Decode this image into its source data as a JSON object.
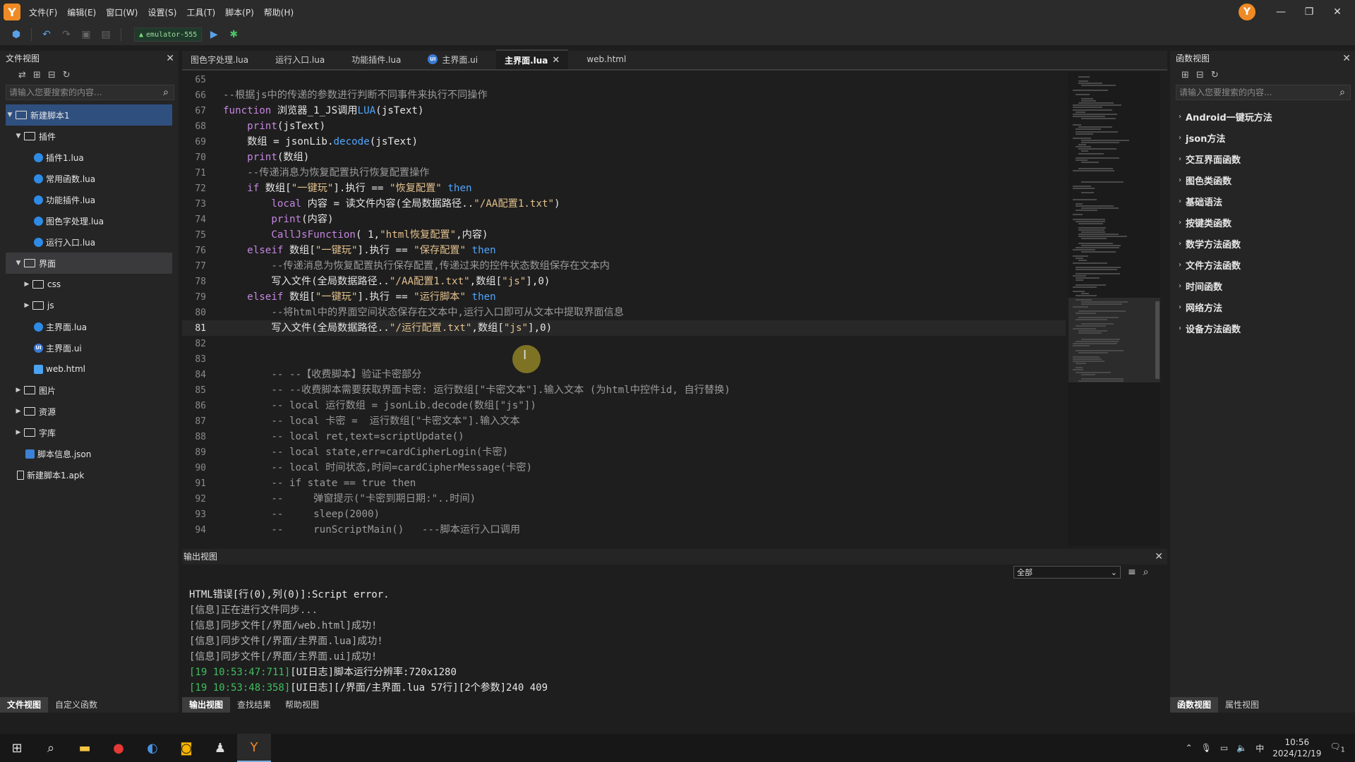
{
  "menu": {
    "items": [
      "文件(F)",
      "编辑(E)",
      "窗口(W)",
      "设置(S)",
      "工具(T)",
      "脚本(P)",
      "帮助(H)"
    ],
    "avatar_letter": "Y"
  },
  "toolbar": {
    "device": "emulator-555"
  },
  "file_view": {
    "title": "文件视图",
    "search_placeholder": "请输入您要搜索的内容...",
    "tree": [
      {
        "label": "新建脚本1",
        "type": "folder",
        "depth": 0,
        "expanded": true,
        "selected": true
      },
      {
        "label": "插件",
        "type": "folder",
        "depth": 1,
        "expanded": true
      },
      {
        "label": "插件1.lua",
        "type": "lua",
        "depth": 2
      },
      {
        "label": "常用函数.lua",
        "type": "lua",
        "depth": 2
      },
      {
        "label": "功能插件.lua",
        "type": "lua",
        "depth": 2
      },
      {
        "label": "图色字处理.lua",
        "type": "lua",
        "depth": 2
      },
      {
        "label": "运行入口.lua",
        "type": "lua",
        "depth": 2
      },
      {
        "label": "界面",
        "type": "folder",
        "depth": 1,
        "expanded": true,
        "highlight": true
      },
      {
        "label": "css",
        "type": "folder",
        "depth": 2,
        "expanded": false
      },
      {
        "label": "js",
        "type": "folder",
        "depth": 2,
        "expanded": false
      },
      {
        "label": "主界面.lua",
        "type": "lua",
        "depth": 2
      },
      {
        "label": "主界面.ui",
        "type": "ui",
        "depth": 2
      },
      {
        "label": "web.html",
        "type": "html",
        "depth": 2
      },
      {
        "label": "图片",
        "type": "folder",
        "depth": 1,
        "expanded": false
      },
      {
        "label": "资源",
        "type": "folder",
        "depth": 1,
        "expanded": false
      },
      {
        "label": "字库",
        "type": "folder",
        "depth": 1,
        "expanded": false
      },
      {
        "label": "脚本信息.json",
        "type": "json",
        "depth": 1
      },
      {
        "label": "新建脚本1.apk",
        "type": "apk",
        "depth": 0
      }
    ],
    "bottom_tabs": [
      "文件视图",
      "自定义函数"
    ]
  },
  "editor": {
    "tabs": [
      {
        "label": "图色字处理.lua",
        "icon": ""
      },
      {
        "label": "运行入口.lua",
        "icon": ""
      },
      {
        "label": "功能插件.lua",
        "icon": ""
      },
      {
        "label": "主界面.ui",
        "icon": "UI"
      },
      {
        "label": "主界面.lua",
        "icon": "",
        "active": true
      },
      {
        "label": "web.html",
        "icon": ""
      }
    ],
    "current_line": 81,
    "lines": [
      {
        "n": "65",
        "segs": []
      },
      {
        "n": "66",
        "segs": [
          {
            "t": "--根据js中的传递的参数进行判断不同事件来执行不同操作",
            "c": "c-comment"
          }
        ]
      },
      {
        "n": "67",
        "segs": [
          {
            "t": "function ",
            "c": "c-kw"
          },
          {
            "t": "浏览器_1_JS",
            "c": "c-id"
          },
          {
            "t": "调用",
            "c": "c-id"
          },
          {
            "t": "LUA",
            "c": "c-blue"
          },
          {
            "t": "(jsText)",
            "c": "c-id"
          }
        ]
      },
      {
        "n": "68",
        "segs": [
          {
            "t": "    ",
            "c": ""
          },
          {
            "t": "print",
            "c": "c-kw"
          },
          {
            "t": "(jsText)",
            "c": "c-id"
          }
        ]
      },
      {
        "n": "69",
        "segs": [
          {
            "t": "    ",
            "c": ""
          },
          {
            "t": "数组 = jsonLib.",
            "c": "c-id"
          },
          {
            "t": "decode",
            "c": "c-blue"
          },
          {
            "t": "(jsText)",
            "c": "c-id"
          }
        ]
      },
      {
        "n": "70",
        "segs": [
          {
            "t": "    ",
            "c": ""
          },
          {
            "t": "print",
            "c": "c-kw"
          },
          {
            "t": "(数组)",
            "c": "c-id"
          }
        ]
      },
      {
        "n": "71",
        "segs": [
          {
            "t": "    ",
            "c": ""
          },
          {
            "t": "--传递消息为恢复配置执行恢复配置操作",
            "c": "c-comment"
          }
        ]
      },
      {
        "n": "72",
        "segs": [
          {
            "t": "    ",
            "c": ""
          },
          {
            "t": "if ",
            "c": "c-kw"
          },
          {
            "t": "数组[",
            "c": "c-id"
          },
          {
            "t": "\"一键玩\"",
            "c": "c-str"
          },
          {
            "t": "].执行 == ",
            "c": "c-id"
          },
          {
            "t": "\"恢复配置\"",
            "c": "c-str"
          },
          {
            "t": " then",
            "c": "c-blue"
          }
        ]
      },
      {
        "n": "73",
        "segs": [
          {
            "t": "        ",
            "c": ""
          },
          {
            "t": "local ",
            "c": "c-kw"
          },
          {
            "t": "内容 = 读文件内容(全局数据路径..",
            "c": "c-id"
          },
          {
            "t": "\"/AA配置1.txt\"",
            "c": "c-str"
          },
          {
            "t": ")",
            "c": "c-id"
          }
        ]
      },
      {
        "n": "74",
        "segs": [
          {
            "t": "        ",
            "c": ""
          },
          {
            "t": "print",
            "c": "c-kw"
          },
          {
            "t": "(内容)",
            "c": "c-id"
          }
        ]
      },
      {
        "n": "75",
        "segs": [
          {
            "t": "        ",
            "c": ""
          },
          {
            "t": "CallJsFunction",
            "c": "c-kw"
          },
          {
            "t": "( 1,",
            "c": "c-id"
          },
          {
            "t": "\"html恢复配置\"",
            "c": "c-str"
          },
          {
            "t": ",内容)",
            "c": "c-id"
          }
        ]
      },
      {
        "n": "76",
        "segs": [
          {
            "t": "    ",
            "c": ""
          },
          {
            "t": "elseif ",
            "c": "c-kw"
          },
          {
            "t": "数组[",
            "c": "c-id"
          },
          {
            "t": "\"一键玩\"",
            "c": "c-str"
          },
          {
            "t": "].执行 == ",
            "c": "c-id"
          },
          {
            "t": "\"保存配置\"",
            "c": "c-str"
          },
          {
            "t": " then",
            "c": "c-blue"
          }
        ]
      },
      {
        "n": "77",
        "segs": [
          {
            "t": "        ",
            "c": ""
          },
          {
            "t": "--传递消息为恢复配置执行保存配置,传递过来的控件状态数组保存在文本内",
            "c": "c-comment"
          }
        ]
      },
      {
        "n": "78",
        "segs": [
          {
            "t": "        ",
            "c": ""
          },
          {
            "t": "写入文件(全局数据路径..",
            "c": "c-id"
          },
          {
            "t": "\"/AA配置1.txt\"",
            "c": "c-str"
          },
          {
            "t": ",数组[",
            "c": "c-id"
          },
          {
            "t": "\"js\"",
            "c": "c-str"
          },
          {
            "t": "],0)",
            "c": "c-id"
          }
        ]
      },
      {
        "n": "79",
        "segs": [
          {
            "t": "    ",
            "c": ""
          },
          {
            "t": "elseif ",
            "c": "c-kw"
          },
          {
            "t": "数组[",
            "c": "c-id"
          },
          {
            "t": "\"一键玩\"",
            "c": "c-str"
          },
          {
            "t": "].执行 == ",
            "c": "c-id"
          },
          {
            "t": "\"运行脚本\"",
            "c": "c-str"
          },
          {
            "t": " then",
            "c": "c-blue"
          }
        ]
      },
      {
        "n": "80",
        "segs": [
          {
            "t": "        ",
            "c": ""
          },
          {
            "t": "--将html中的界面空间状态保存在文本中,运行入口即可从文本中提取界面信息",
            "c": "c-comment"
          }
        ]
      },
      {
        "n": "81",
        "segs": [
          {
            "t": "        ",
            "c": ""
          },
          {
            "t": "写入文件(全局数据路径..",
            "c": "c-id"
          },
          {
            "t": "\"/运行配置.txt\"",
            "c": "c-str"
          },
          {
            "t": ",数组[",
            "c": "c-id"
          },
          {
            "t": "\"js\"",
            "c": "c-str"
          },
          {
            "t": "],0)",
            "c": "c-id"
          }
        ]
      },
      {
        "n": "82",
        "segs": []
      },
      {
        "n": "83",
        "segs": []
      },
      {
        "n": "84",
        "segs": [
          {
            "t": "        ",
            "c": ""
          },
          {
            "t": "-- --【收费脚本】验证卡密部分",
            "c": "c-comment"
          }
        ]
      },
      {
        "n": "85",
        "segs": [
          {
            "t": "        ",
            "c": ""
          },
          {
            "t": "-- --收费脚本需要获取界面卡密: 运行数组[\"卡密文本\"].输入文本 (为html中控件id, 自行替换)",
            "c": "c-comment"
          }
        ]
      },
      {
        "n": "86",
        "segs": [
          {
            "t": "        ",
            "c": ""
          },
          {
            "t": "-- local 运行数组 = jsonLib.decode(数组[\"js\"])",
            "c": "c-comment"
          }
        ]
      },
      {
        "n": "87",
        "segs": [
          {
            "t": "        ",
            "c": ""
          },
          {
            "t": "-- local 卡密 =  运行数组[\"卡密文本\"].输入文本",
            "c": "c-comment"
          }
        ]
      },
      {
        "n": "88",
        "segs": [
          {
            "t": "        ",
            "c": ""
          },
          {
            "t": "-- local ret,text=scriptUpdate()",
            "c": "c-comment"
          }
        ]
      },
      {
        "n": "89",
        "segs": [
          {
            "t": "        ",
            "c": ""
          },
          {
            "t": "-- local state,err=cardCipherLogin(卡密)",
            "c": "c-comment"
          }
        ]
      },
      {
        "n": "90",
        "segs": [
          {
            "t": "        ",
            "c": ""
          },
          {
            "t": "-- local 时间状态,时间=cardCipherMessage(卡密)",
            "c": "c-comment"
          }
        ]
      },
      {
        "n": "91",
        "segs": [
          {
            "t": "        ",
            "c": ""
          },
          {
            "t": "-- if state == true then",
            "c": "c-comment"
          }
        ]
      },
      {
        "n": "92",
        "segs": [
          {
            "t": "        ",
            "c": ""
          },
          {
            "t": "--     弹窗提示(\"卡密到期日期:\"..时间)",
            "c": "c-comment"
          }
        ]
      },
      {
        "n": "93",
        "segs": [
          {
            "t": "        ",
            "c": ""
          },
          {
            "t": "--     sleep(2000)",
            "c": "c-comment"
          }
        ]
      },
      {
        "n": "94",
        "segs": [
          {
            "t": "        ",
            "c": ""
          },
          {
            "t": "--     runScriptMain()   ---脚本运行入口调用",
            "c": "c-comment"
          }
        ]
      }
    ]
  },
  "output": {
    "title": "输出视图",
    "filter": "全部",
    "lines": [
      {
        "t": "HTML错误[行(0),列(0)]:Script error.",
        "c": "o-white"
      },
      {
        "t": "[信息]正在进行文件同步...",
        "c": "o-gray"
      },
      {
        "t": "[信息]同步文件[/界面/web.html]成功!",
        "c": "o-gray"
      },
      {
        "t": "[信息]同步文件[/界面/主界面.lua]成功!",
        "c": "o-gray"
      },
      {
        "t": "[信息]同步文件[/界面/主界面.ui]成功!",
        "c": "o-gray"
      },
      {
        "ts": "[19 10:53:47:711]",
        "t": "[UI日志]脚本运行分辨率:720x1280",
        "c": "o-white"
      },
      {
        "ts": "[19 10:53:48:358]",
        "t": "[UI日志][/界面/主界面.lua 57行][2个参数]240 409",
        "c": "o-white"
      }
    ],
    "bottom_tabs": [
      "输出视图",
      "查找结果",
      "帮助视图"
    ]
  },
  "func_view": {
    "title": "函数视图",
    "search_placeholder": "请输入您要搜索的内容...",
    "items": [
      "Android一键玩方法",
      "json方法",
      "交互界面函数",
      "图色类函数",
      "基础语法",
      "按键类函数",
      "数学方法函数",
      "文件方法函数",
      "时间函数",
      "网络方法",
      "设备方法函数"
    ],
    "bottom_tabs": [
      "函数视图",
      "属性视图"
    ]
  },
  "taskbar": {
    "time": "10:56",
    "date": "2024/12/19",
    "ime": "中",
    "notify_count": "1"
  }
}
